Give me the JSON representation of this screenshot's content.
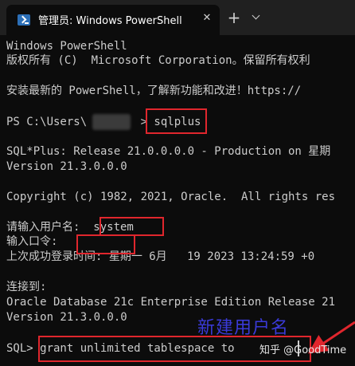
{
  "window": {
    "tab_title": "管理员: Windows PowerShell",
    "tab_close": "✕",
    "new_tab": "+",
    "tab_icon": "powershell-icon",
    "dropdown_icon": "chevron-down-icon"
  },
  "terminal": {
    "lines": [
      "Windows PowerShell",
      "版权所有 (C)  Microsoft Corporation。保留所有权利",
      "",
      "安装最新的 PowerShell，了解新功能和改进！https://",
      "",
      "PS C:\\Users\\        > sqlplus",
      "",
      "SQL*Plus: Release 21.0.0.0.0 - Production on 星期",
      "Version 21.3.0.0.0",
      "",
      "Copyright (c) 1982, 2021, Oracle.  All rights res",
      "",
      "请输入用户名:  system",
      "输入口令:",
      "上次成功登录时间: 星期一 6月   19 2023 13:24:59 +0",
      "",
      "连接到:",
      "Oracle Database 21c Enterprise Edition Release 21",
      "Version 21.3.0.0.0",
      "",
      "SQL> grant unlimited tablespace to"
    ]
  },
  "annotation": {
    "label": "新建用户名",
    "color": "#3a3ad8"
  },
  "watermark": "知乎 @GoodTime",
  "colors": {
    "terminal_bg": "#0c0c0c",
    "text": "#cccccc",
    "highlight_box": "#e0262d",
    "titlebar": "#202020"
  }
}
